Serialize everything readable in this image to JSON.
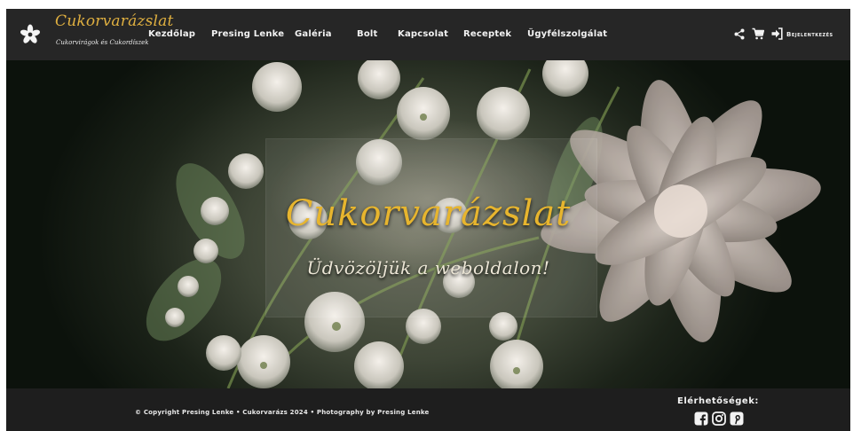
{
  "brand": {
    "title": "Cukorvarázslat",
    "subtitle": "Cukorvirágok és Cukordíszek"
  },
  "nav": {
    "items": [
      {
        "label": "Kezdőlap"
      },
      {
        "label": "Presing Lenke"
      },
      {
        "label": "Galéria"
      },
      {
        "label": "Bolt"
      },
      {
        "label": "Kapcsolat"
      },
      {
        "label": "Receptek"
      },
      {
        "label": "Ügyfélszolgálat"
      }
    ],
    "login_label": "Bejelentkezés"
  },
  "hero": {
    "title": "Cukorvarázslat",
    "subtitle": "Üdvözöljük a weboldalon!"
  },
  "footer": {
    "copyright": "© Copyright Presing Lenke • Cukorvarázs 2024 • Photography by Presing Lenke",
    "contact_heading": "Elérhetőségek:",
    "social_icons": [
      "facebook-icon",
      "instagram-icon",
      "pinterest-icon"
    ]
  },
  "colors": {
    "nav_bg": "#262626",
    "brand_gold": "#e0b040",
    "hero_title": "#e7b52e",
    "footer_bg": "#1e1e1e"
  }
}
